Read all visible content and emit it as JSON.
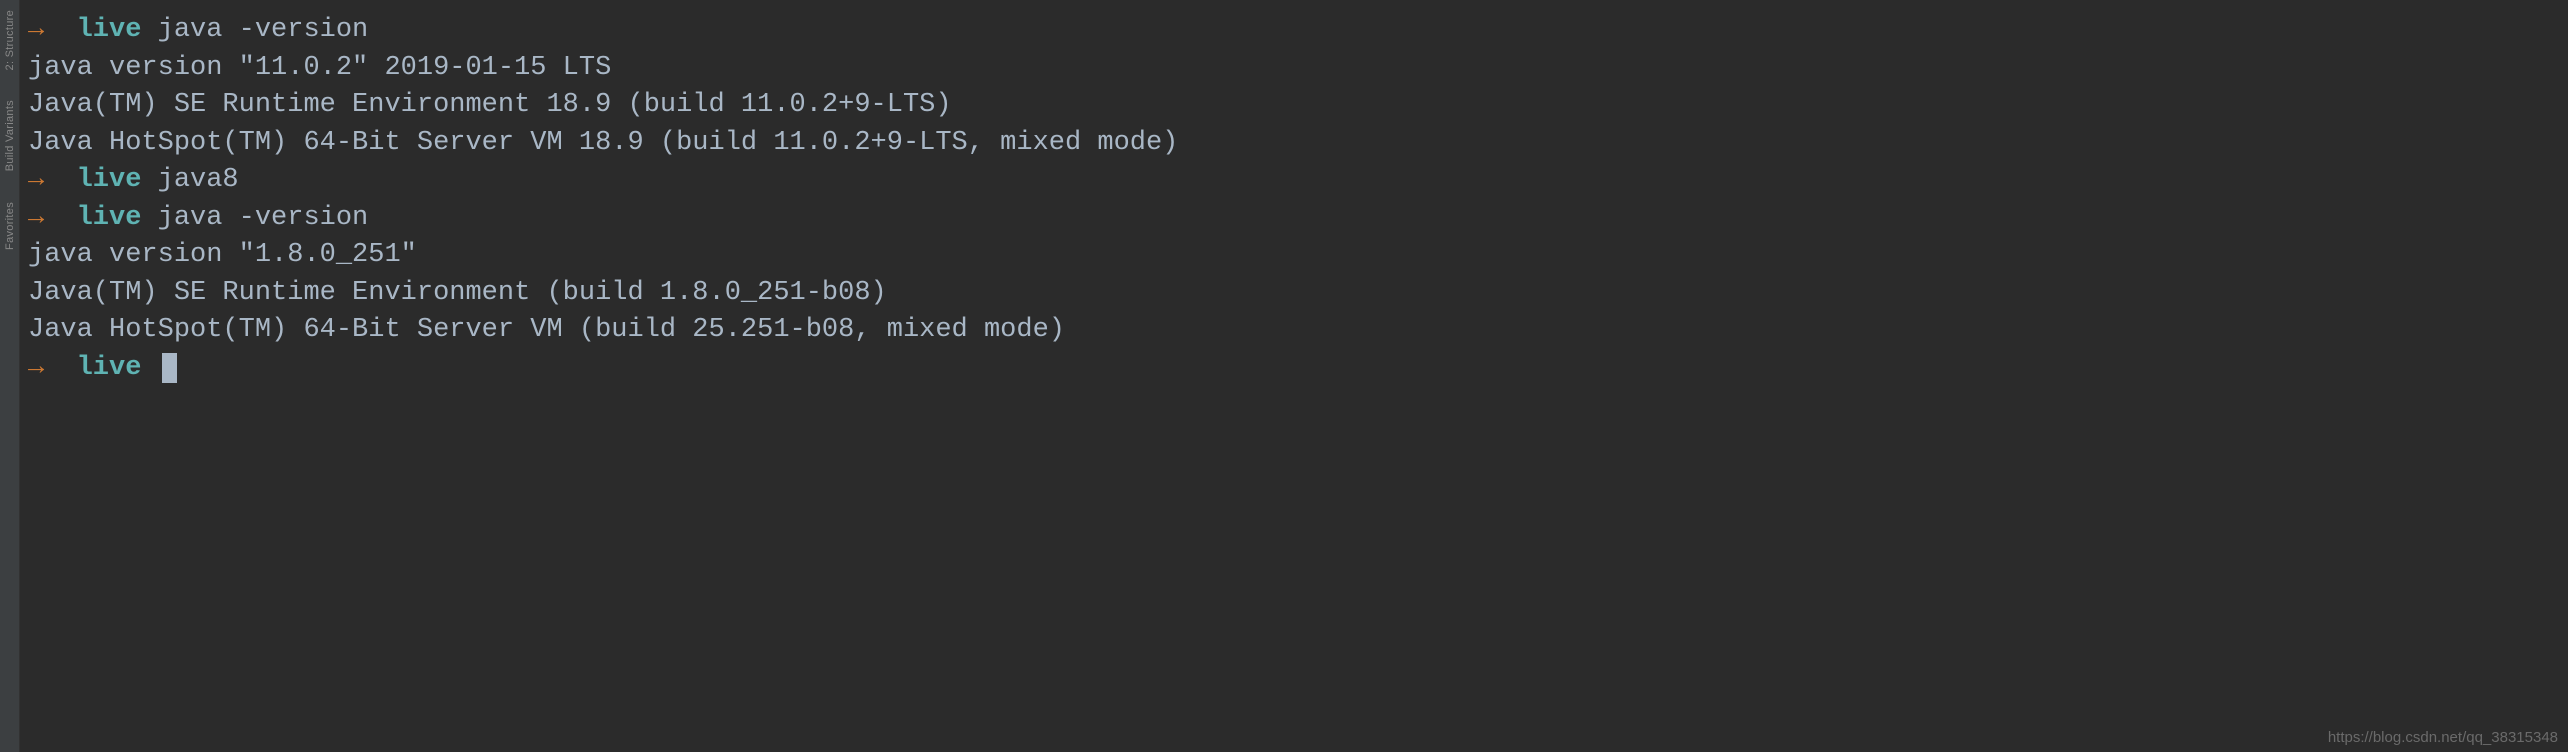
{
  "sidebar": {
    "tabs": [
      {
        "label": "2: Structure"
      },
      {
        "label": "Build Variants"
      },
      {
        "label": "Favorites"
      }
    ]
  },
  "terminal": {
    "arrow": "→",
    "venv": "live",
    "lines": [
      {
        "type": "prompt",
        "cmd": "java -version"
      },
      {
        "type": "out",
        "text": "java version \"11.0.2\" 2019-01-15 LTS"
      },
      {
        "type": "out",
        "text": "Java(TM) SE Runtime Environment 18.9 (build 11.0.2+9-LTS)"
      },
      {
        "type": "out",
        "text": "Java HotSpot(TM) 64-Bit Server VM 18.9 (build 11.0.2+9-LTS, mixed mode)"
      },
      {
        "type": "prompt",
        "cmd": "java8"
      },
      {
        "type": "prompt",
        "cmd": "java -version"
      },
      {
        "type": "out",
        "text": "java version \"1.8.0_251\""
      },
      {
        "type": "out",
        "text": "Java(TM) SE Runtime Environment (build 1.8.0_251-b08)"
      },
      {
        "type": "out",
        "text": "Java HotSpot(TM) 64-Bit Server VM (build 25.251-b08, mixed mode)"
      },
      {
        "type": "prompt",
        "cmd": "",
        "cursor": true
      }
    ]
  },
  "watermark": "https://blog.csdn.net/qq_38315348"
}
